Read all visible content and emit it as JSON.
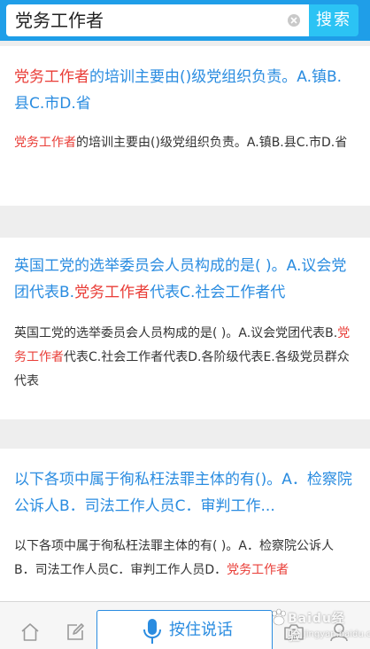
{
  "search": {
    "value": "党务工作者",
    "button_label": "搜索"
  },
  "results": [
    {
      "title_parts": [
        "党务工作者",
        "的培训主要由()级党组织负责。A.镇B.县C.市D.省"
      ],
      "snippet_parts": [
        "党务工作者",
        "的培训主要由()级党组织负责。A.镇B.县C.市D.省"
      ]
    },
    {
      "title_parts": [
        "英国工党的选举委员会人员构成的是( )。A.议会党团代表B.",
        "党务工作者",
        "代表C.社会工作者代"
      ],
      "snippet_parts": [
        "英国工党的选举委员会人员构成的是( )。A.议会党团代表B.",
        "党务工作者",
        "代表C.社会工作者代表D.各阶级代表E.各级党员群众代表"
      ]
    },
    {
      "title_parts": [
        "以下各项中属于徇私枉法罪主体的有()。A．检察院公诉人B．司法工作人员C．审判工作..."
      ],
      "snippet_parts": [
        "以下各项中属于徇私枉法罪主体的有( )。A．检察院公诉人B．司法工作人员C．审判工作人员D．",
        "党务工作者"
      ]
    }
  ],
  "bottom_bar": {
    "voice_label": "按住说话",
    "icons": [
      "home-icon",
      "edit-icon",
      "microphone-icon",
      "camera-icon",
      "user-icon"
    ]
  },
  "watermark": {
    "text": "Baidu经验",
    "sub": "jingyan.baidu.com"
  },
  "colors": {
    "header": "#1f9ee8",
    "search_button": "#2bc3f4",
    "title": "#2a8ce0",
    "highlight": "#e93d37",
    "snippet": "#333333",
    "page_bg": "#eeeeee"
  }
}
